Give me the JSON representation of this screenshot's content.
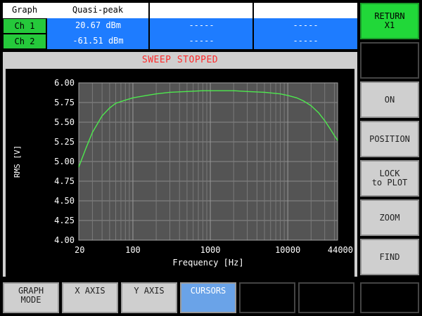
{
  "readout": {
    "headers": [
      "Graph",
      "Quasi-peak",
      "",
      ""
    ],
    "rows": [
      {
        "label": "Ch 1",
        "values": [
          "20.67  dBm",
          "-----",
          "-----"
        ]
      },
      {
        "label": "Ch 2",
        "values": [
          "-61.51  dBm",
          "-----",
          "-----"
        ]
      }
    ]
  },
  "status": {
    "text": "SWEEP STOPPED",
    "color": "#ff2c2c"
  },
  "right_buttons": [
    {
      "label": "RETURN\nX1",
      "style": "green"
    },
    {
      "label": "",
      "style": "black"
    },
    {
      "label": "ON",
      "style": "normal"
    },
    {
      "label": "POSITION",
      "style": "normal"
    },
    {
      "label": "LOCK\nto PLOT",
      "style": "normal"
    },
    {
      "label": "ZOOM",
      "style": "normal"
    },
    {
      "label": "FIND",
      "style": "normal"
    }
  ],
  "bottom_buttons": [
    {
      "label": "GRAPH\nMODE",
      "style": "normal"
    },
    {
      "label": "X AXIS",
      "style": "normal"
    },
    {
      "label": "Y AXIS",
      "style": "normal"
    },
    {
      "label": "CURSORS",
      "style": "active"
    },
    {
      "label": "",
      "style": "black"
    },
    {
      "label": "",
      "style": "black"
    },
    {
      "label": "",
      "style": "black"
    }
  ],
  "chart_data": {
    "type": "line",
    "xlabel": "Frequency [Hz]",
    "ylabel": "RMS [V]",
    "xscale": "log",
    "xlim": [
      20,
      44000
    ],
    "ylim": [
      4.0,
      6.0
    ],
    "xticks": [
      20,
      100,
      1000,
      10000,
      44000
    ],
    "xtick_labels": [
      "20",
      "100",
      "1000",
      "10000",
      "44000"
    ],
    "yticks": [
      4.0,
      4.25,
      4.5,
      4.75,
      5.0,
      5.25,
      5.5,
      5.75,
      6.0
    ],
    "ytick_labels": [
      "4.00",
      "4.25",
      "4.50",
      "4.75",
      "5.00",
      "5.25",
      "5.50",
      "5.75",
      "6.00"
    ],
    "grid": true,
    "series": [
      {
        "color": "#4ee84e",
        "x": [
          20,
          25,
          30,
          40,
          50,
          60,
          80,
          100,
          150,
          200,
          300,
          500,
          800,
          1000,
          2000,
          3000,
          5000,
          8000,
          10000,
          13000,
          16000,
          20000,
          25000,
          30000,
          35000,
          40000,
          44000
        ],
        "y": [
          4.93,
          5.18,
          5.37,
          5.58,
          5.68,
          5.74,
          5.78,
          5.81,
          5.84,
          5.86,
          5.88,
          5.89,
          5.9,
          5.9,
          5.9,
          5.89,
          5.88,
          5.86,
          5.84,
          5.81,
          5.77,
          5.71,
          5.62,
          5.52,
          5.42,
          5.33,
          5.27
        ]
      }
    ]
  }
}
